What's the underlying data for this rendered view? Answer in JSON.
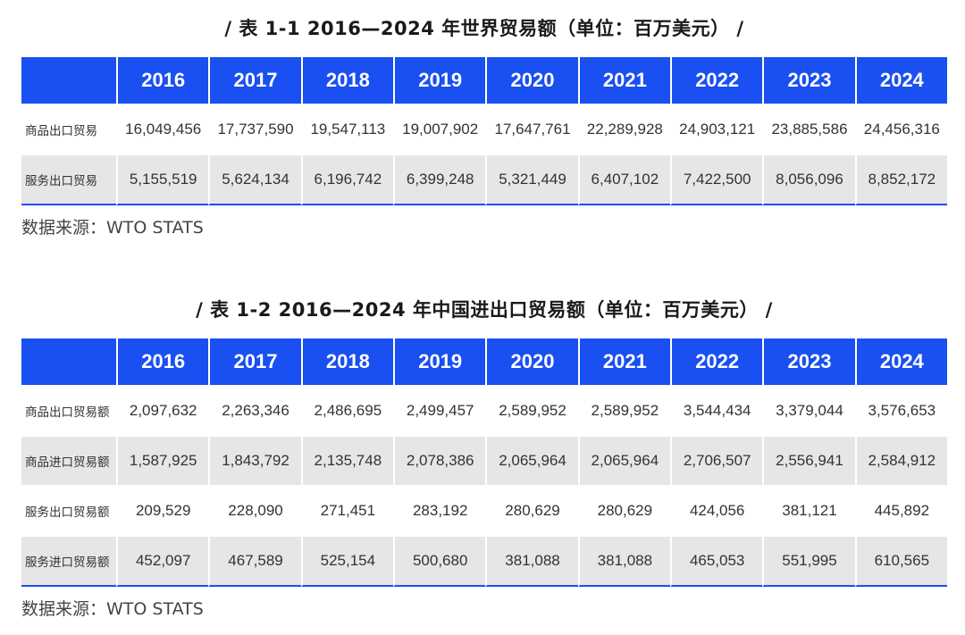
{
  "table1": {
    "title": "/ 表 1-1  2016—2024 年世界贸易额（单位：百万美元） /",
    "years": [
      "2016",
      "2017",
      "2018",
      "2019",
      "2020",
      "2021",
      "2022",
      "2023",
      "2024"
    ],
    "rows": [
      {
        "label": "商品出口贸易",
        "values": [
          "16,049,456",
          "17,737,590",
          "19,547,113",
          "19,007,902",
          "17,647,761",
          "22,289,928",
          "24,903,121",
          "23,885,586",
          "24,456,316"
        ]
      },
      {
        "label": "服务出口贸易",
        "values": [
          "5,155,519",
          "5,624,134",
          "6,196,742",
          "6,399,248",
          "5,321,449",
          "6,407,102",
          "7,422,500",
          "8,056,096",
          "8,852,172"
        ]
      }
    ],
    "source": "数据来源：WTO STATS"
  },
  "table2": {
    "title": "/ 表 1-2  2016—2024 年中国进出口贸易额（单位：百万美元） /",
    "years": [
      "2016",
      "2017",
      "2018",
      "2019",
      "2020",
      "2021",
      "2022",
      "2023",
      "2024"
    ],
    "rows": [
      {
        "label": "商品出口贸易额",
        "values": [
          "2,097,632",
          "2,263,346",
          "2,486,695",
          "2,499,457",
          "2,589,952",
          "2,589,952",
          "3,544,434",
          "3,379,044",
          "3,576,653"
        ]
      },
      {
        "label": "商品进口贸易额",
        "values": [
          "1,587,925",
          "1,843,792",
          "2,135,748",
          "2,078,386",
          "2,065,964",
          "2,065,964",
          "2,706,507",
          "2,556,941",
          "2,584,912"
        ]
      },
      {
        "label": "服务出口贸易额",
        "values": [
          "209,529",
          "228,090",
          "271,451",
          "283,192",
          "280,629",
          "280,629",
          "424,056",
          "381,121",
          "445,892"
        ]
      },
      {
        "label": "服务进口贸易额",
        "values": [
          "452,097",
          "467,589",
          "525,154",
          "500,680",
          "381,088",
          "381,088",
          "465,053",
          "551,995",
          "610,565"
        ]
      }
    ],
    "source": "数据来源：WTO STATS"
  },
  "colors": {
    "header_bg": "#1a4ff2",
    "header_text": "#ffffff",
    "alt_row_bg": "#e6e6e6",
    "bottom_rule": "#1a4ff2"
  }
}
